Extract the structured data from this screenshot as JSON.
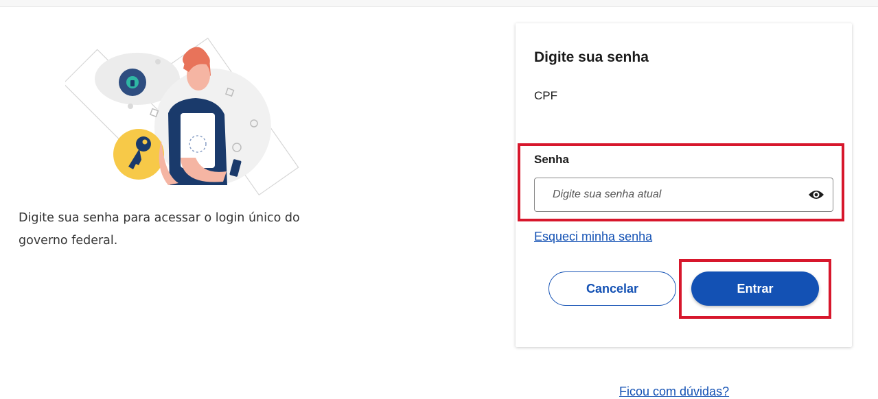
{
  "intro": {
    "text": "Digite sua senha para acessar o login único do governo federal."
  },
  "login_card": {
    "title": "Digite sua senha",
    "cpf_label": "CPF",
    "password_label": "Senha",
    "password_placeholder": "Digite sua senha atual",
    "password_value": "",
    "forgot_link": "Esqueci minha senha",
    "cancel_label": "Cancelar",
    "enter_label": "Entrar"
  },
  "footer": {
    "help_link": "Ficou com dúvidas?"
  },
  "icons": {
    "show_password": "eye-icon",
    "illustration_key": "key-icon",
    "illustration_lock": "lock-icon"
  },
  "colors": {
    "primary": "#1351b4",
    "highlight": "#d7172c",
    "key_badge": "#f7c948",
    "hair": "#e8735a",
    "apron": "#1a3a6b"
  }
}
